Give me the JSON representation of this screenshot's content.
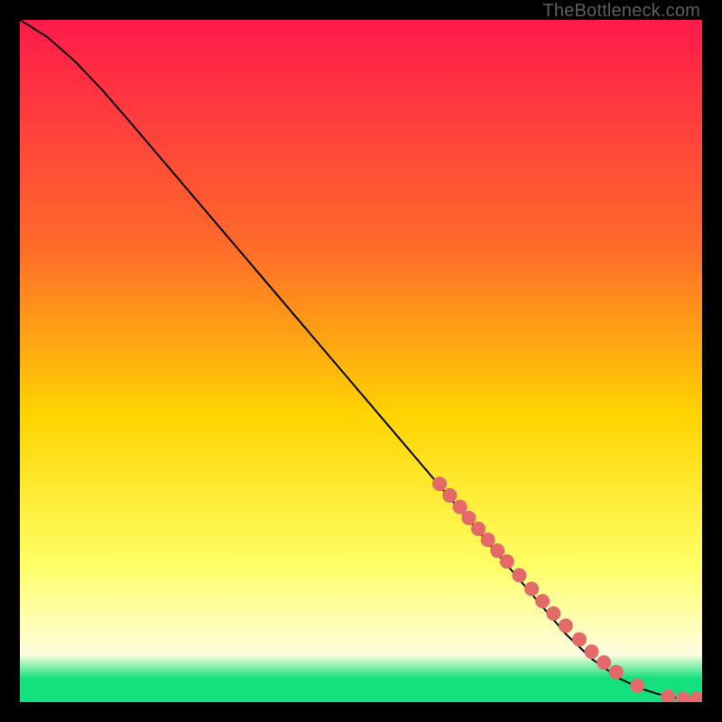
{
  "watermark": "TheBottleneck.com",
  "colors": {
    "bg_black": "#000000",
    "grad_top": "#ff1a4b",
    "grad_mid_upper": "#ff6a2a",
    "grad_mid": "#ffd400",
    "grad_lower": "#ffff66",
    "grad_cream": "#fffde0",
    "grad_green": "#15e07e",
    "line": "#000000",
    "marker": "#e46a6a"
  },
  "chart_data": {
    "type": "line",
    "title": "",
    "xlabel": "",
    "ylabel": "",
    "xlim": [
      0,
      1
    ],
    "ylim": [
      0,
      1
    ],
    "series": [
      {
        "name": "curve",
        "x": [
          0.0,
          0.04,
          0.08,
          0.12,
          0.16,
          0.2,
          0.24,
          0.28,
          0.32,
          0.36,
          0.4,
          0.44,
          0.48,
          0.52,
          0.56,
          0.6,
          0.64,
          0.68,
          0.72,
          0.76,
          0.8,
          0.84,
          0.88,
          0.91,
          0.935,
          0.952,
          0.965,
          0.98,
          1.0
        ],
        "y": [
          1.0,
          0.975,
          0.94,
          0.898,
          0.852,
          0.805,
          0.758,
          0.711,
          0.664,
          0.617,
          0.57,
          0.523,
          0.476,
          0.429,
          0.382,
          0.335,
          0.288,
          0.241,
          0.194,
          0.147,
          0.1,
          0.062,
          0.034,
          0.02,
          0.012,
          0.008,
          0.006,
          0.005,
          0.005
        ]
      }
    ],
    "markers": {
      "name": "highlighted-points",
      "x": [
        0.615,
        0.63,
        0.645,
        0.658,
        0.672,
        0.686,
        0.7,
        0.714,
        0.732,
        0.75,
        0.766,
        0.782,
        0.8,
        0.82,
        0.838,
        0.856,
        0.874,
        0.905,
        0.95,
        0.972,
        0.992
      ],
      "y": [
        0.32,
        0.303,
        0.286,
        0.27,
        0.254,
        0.238,
        0.222,
        0.206,
        0.186,
        0.166,
        0.148,
        0.13,
        0.112,
        0.092,
        0.074,
        0.058,
        0.044,
        0.024,
        0.008,
        0.005,
        0.005
      ]
    }
  }
}
